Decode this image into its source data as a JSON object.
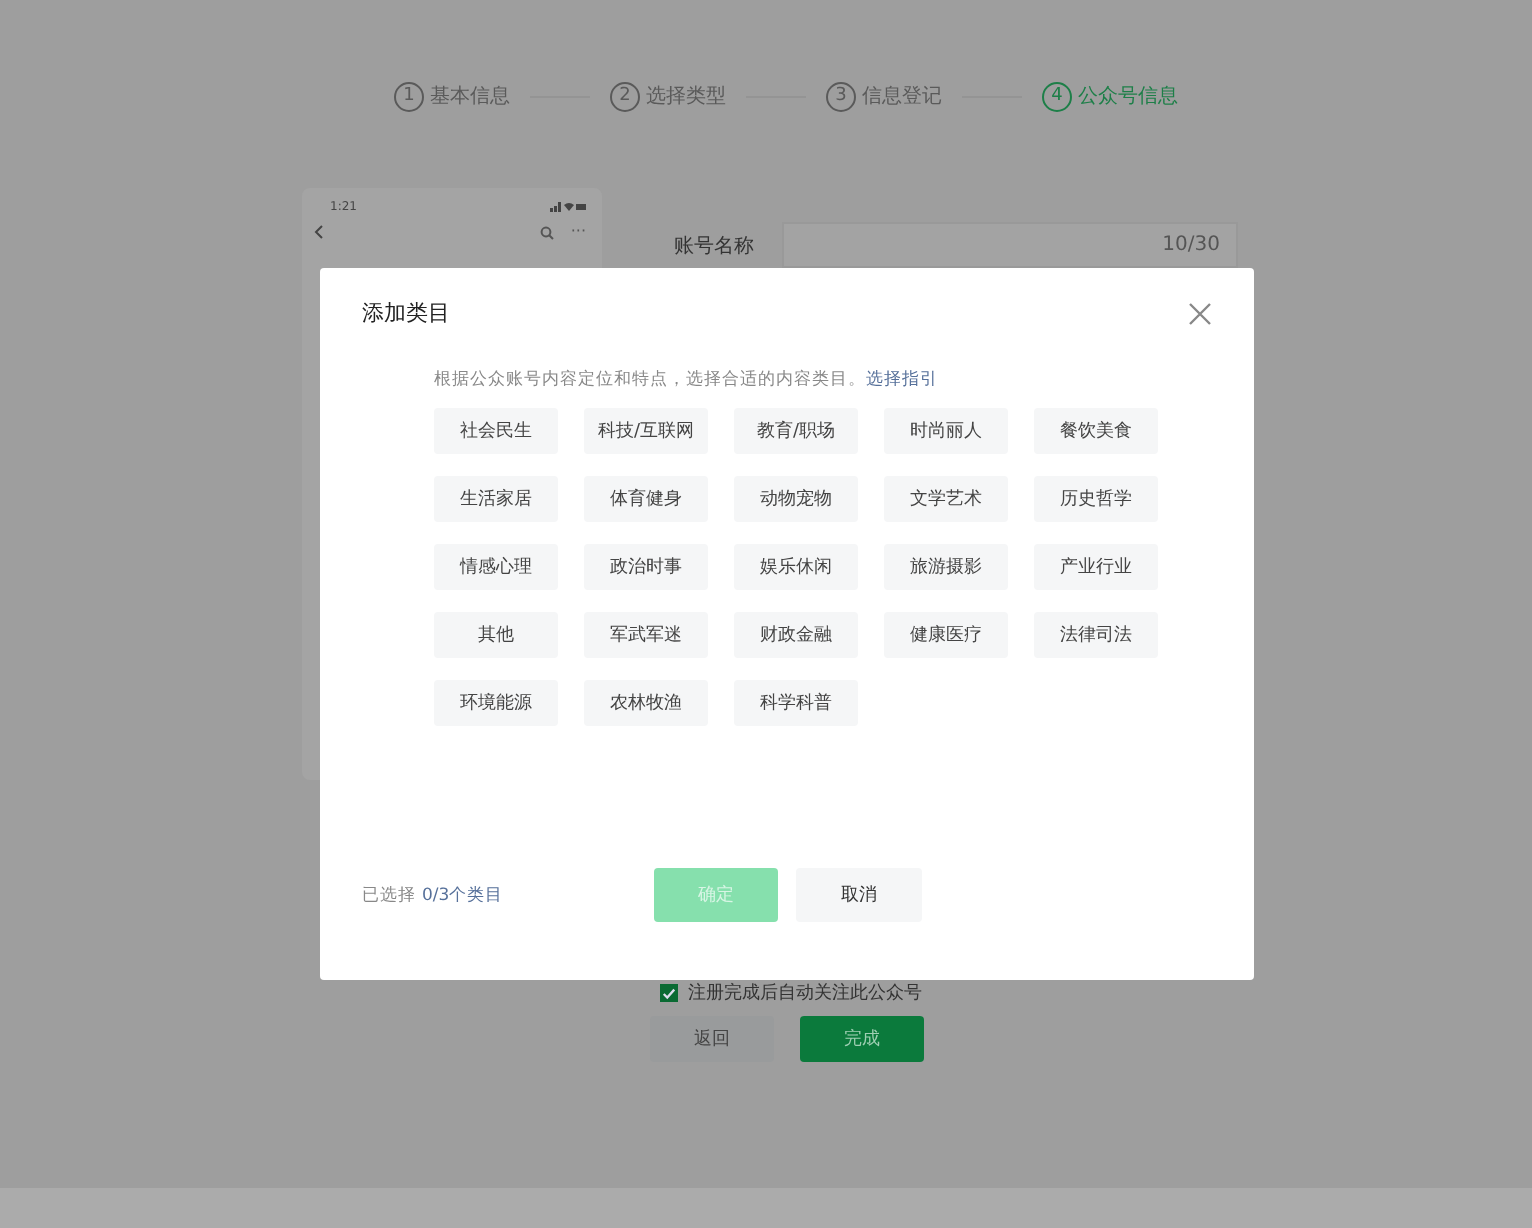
{
  "steps": [
    {
      "number": "1",
      "label": "基本信息",
      "selected": false
    },
    {
      "number": "2",
      "label": "选择类型",
      "selected": false
    },
    {
      "number": "3",
      "label": "信息登记",
      "selected": false
    },
    {
      "number": "4",
      "label": "公众号信息",
      "selected": true
    }
  ],
  "phone_preview": {
    "time": "1:21",
    "more": "···"
  },
  "form": {
    "account_name": {
      "label": "账号名称",
      "counter": "10/30"
    },
    "follow_checkbox": {
      "label": "注册完成后自动关注此公众号",
      "checked": true
    },
    "buttons": [
      {
        "label": "返回",
        "kind": "secondary"
      },
      {
        "label": "完成",
        "kind": "primary"
      }
    ]
  },
  "dialog": {
    "title": "添加类目",
    "description": "根据公众账号内容定位和特点，选择合适的内容类目。",
    "guide_link": "选择指引",
    "categories": [
      {
        "label": "社会民生",
        "selected": false
      },
      {
        "label": "科技/互联网",
        "selected": false
      },
      {
        "label": "教育/职场",
        "selected": false
      },
      {
        "label": "时尚丽人",
        "selected": false
      },
      {
        "label": "餐饮美食",
        "selected": false
      },
      {
        "label": "生活家居",
        "selected": false
      },
      {
        "label": "体育健身",
        "selected": false
      },
      {
        "label": "动物宠物",
        "selected": false
      },
      {
        "label": "文学艺术",
        "selected": false
      },
      {
        "label": "历史哲学",
        "selected": false
      },
      {
        "label": "情感心理",
        "selected": false
      },
      {
        "label": "政治时事",
        "selected": false
      },
      {
        "label": "娱乐休闲",
        "selected": false
      },
      {
        "label": "旅游摄影",
        "selected": false
      },
      {
        "label": "产业行业",
        "selected": false
      },
      {
        "label": "其他",
        "selected": false
      },
      {
        "label": "军武军迷",
        "selected": false
      },
      {
        "label": "财政金融",
        "selected": false
      },
      {
        "label": "健康医疗",
        "selected": false
      },
      {
        "label": "法律司法",
        "selected": false
      },
      {
        "label": "环境能源",
        "selected": false
      },
      {
        "label": "农林牧渔",
        "selected": false
      },
      {
        "label": "科学科普",
        "selected": false
      }
    ],
    "selected_prefix": "已选择",
    "selected_count": "0/3个类目",
    "confirm": {
      "label": "确定",
      "disabled": true
    },
    "cancel": {
      "label": "取消"
    }
  }
}
